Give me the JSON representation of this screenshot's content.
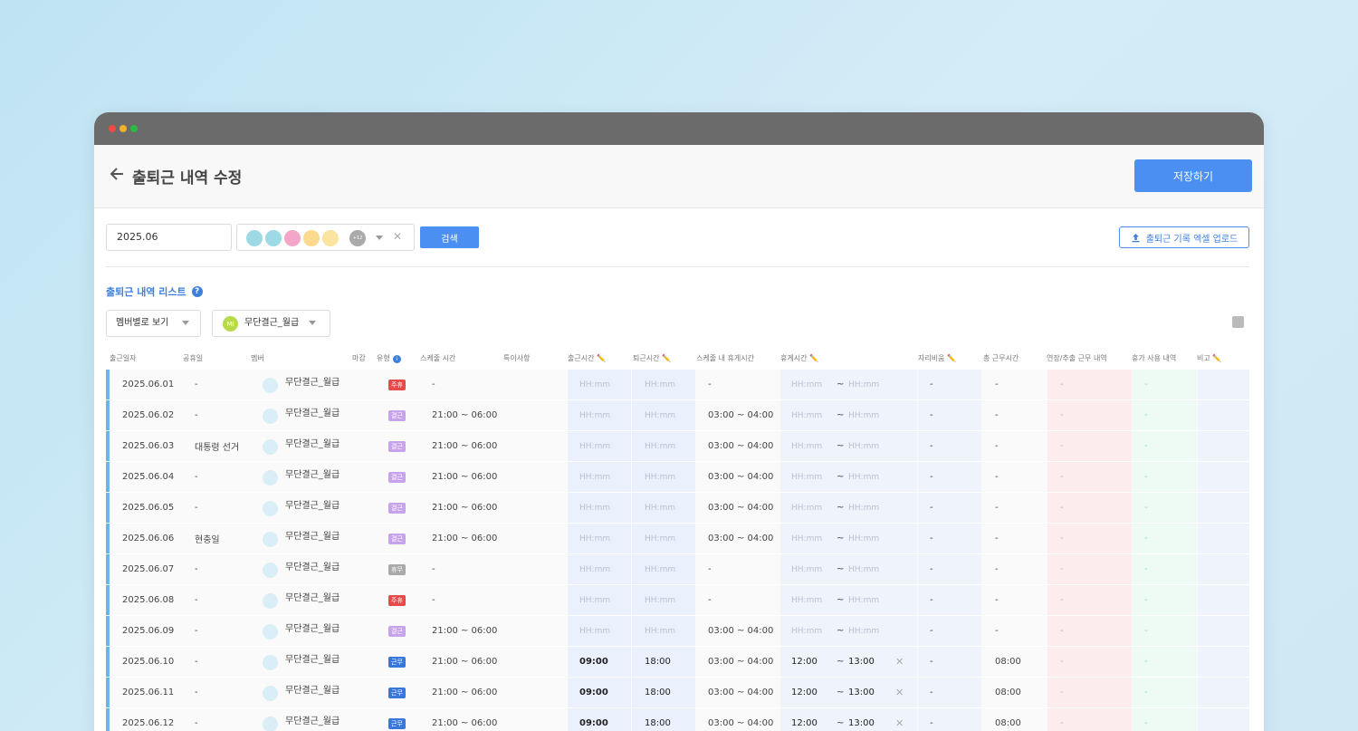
{
  "header": {
    "title": "출퇴근 내역 수정",
    "save_label": "저장하기"
  },
  "filters": {
    "date": "2025.06",
    "member_more": "+12",
    "search_label": "검색",
    "upload_label": "출퇴근 기록 엑셀 업로드"
  },
  "list": {
    "title": "출퇴근 내역 리스트",
    "view_select": "멤버별로 보기",
    "member_select": "무단결근_월급",
    "member_initials": "MI"
  },
  "columns": [
    "출근일자",
    "공휴일",
    "멤버",
    "마감",
    "유형",
    "스케줄 시간",
    "특이사항",
    "출근시간",
    "퇴근시간",
    "스케줄 내 휴게시간",
    "휴게시간",
    "자리비움",
    "총 근무시간",
    "연장/추출 근무 내역",
    "휴가 사용 내역",
    "비고"
  ],
  "placeholders": {
    "time": "HH:mm",
    "tilde": "~",
    "dash": "-"
  },
  "rows": [
    {
      "date": "2025.06.01",
      "holiday": "-",
      "member": "무단결근_월급",
      "type": "주휴",
      "type_color": "red",
      "schedule": "-",
      "in": "",
      "out": "",
      "sched_break": "-",
      "break_start": "",
      "break_end": "",
      "away": "-",
      "total": "-",
      "overtime": "-",
      "leave": "-"
    },
    {
      "date": "2025.06.02",
      "holiday": "-",
      "member": "무단결근_월급",
      "type": "결근",
      "type_color": "purple",
      "schedule": "21:00 ~ 06:00",
      "in": "",
      "out": "",
      "sched_break": "03:00 ~ 04:00",
      "break_start": "",
      "break_end": "",
      "away": "-",
      "total": "-",
      "overtime": "-",
      "leave": "-"
    },
    {
      "date": "2025.06.03",
      "holiday": "대통령 선거",
      "member": "무단결근_월급",
      "type": "결근",
      "type_color": "purple",
      "schedule": "21:00 ~ 06:00",
      "in": "",
      "out": "",
      "sched_break": "03:00 ~ 04:00",
      "break_start": "",
      "break_end": "",
      "away": "-",
      "total": "-",
      "overtime": "-",
      "leave": "-"
    },
    {
      "date": "2025.06.04",
      "holiday": "-",
      "member": "무단결근_월급",
      "type": "결근",
      "type_color": "purple",
      "schedule": "21:00 ~ 06:00",
      "in": "",
      "out": "",
      "sched_break": "03:00 ~ 04:00",
      "break_start": "",
      "break_end": "",
      "away": "-",
      "total": "-",
      "overtime": "-",
      "leave": "-"
    },
    {
      "date": "2025.06.05",
      "holiday": "-",
      "member": "무단결근_월급",
      "type": "결근",
      "type_color": "purple",
      "schedule": "21:00 ~ 06:00",
      "in": "",
      "out": "",
      "sched_break": "03:00 ~ 04:00",
      "break_start": "",
      "break_end": "",
      "away": "-",
      "total": "-",
      "overtime": "-",
      "leave": "-"
    },
    {
      "date": "2025.06.06",
      "holiday": "현충일",
      "member": "무단결근_월급",
      "type": "결근",
      "type_color": "purple",
      "schedule": "21:00 ~ 06:00",
      "in": "",
      "out": "",
      "sched_break": "03:00 ~ 04:00",
      "break_start": "",
      "break_end": "",
      "away": "-",
      "total": "-",
      "overtime": "-",
      "leave": "-"
    },
    {
      "date": "2025.06.07",
      "holiday": "-",
      "member": "무단결근_월급",
      "type": "휴무",
      "type_color": "gray",
      "schedule": "-",
      "in": "",
      "out": "",
      "sched_break": "-",
      "break_start": "",
      "break_end": "",
      "away": "-",
      "total": "-",
      "overtime": "-",
      "leave": "-"
    },
    {
      "date": "2025.06.08",
      "holiday": "-",
      "member": "무단결근_월급",
      "type": "주휴",
      "type_color": "red",
      "schedule": "-",
      "in": "",
      "out": "",
      "sched_break": "-",
      "break_start": "",
      "break_end": "",
      "away": "-",
      "total": "-",
      "overtime": "-",
      "leave": "-"
    },
    {
      "date": "2025.06.09",
      "holiday": "-",
      "member": "무단결근_월급",
      "type": "결근",
      "type_color": "purple",
      "schedule": "21:00 ~ 06:00",
      "in": "",
      "out": "",
      "sched_break": "03:00 ~ 04:00",
      "break_start": "",
      "break_end": "",
      "away": "-",
      "total": "-",
      "overtime": "-",
      "leave": "-"
    },
    {
      "date": "2025.06.10",
      "holiday": "-",
      "member": "무단결근_월급",
      "type": "근무",
      "type_color": "blue",
      "schedule": "21:00 ~ 06:00",
      "in": "09:00",
      "out": "18:00",
      "sched_break": "03:00 ~ 04:00",
      "break_start": "12:00",
      "break_end": "13:00",
      "away": "-",
      "total": "08:00",
      "overtime": "-",
      "leave": "-"
    },
    {
      "date": "2025.06.11",
      "holiday": "-",
      "member": "무단결근_월급",
      "type": "근무",
      "type_color": "blue",
      "schedule": "21:00 ~ 06:00",
      "in": "09:00",
      "out": "18:00",
      "sched_break": "03:00 ~ 04:00",
      "break_start": "12:00",
      "break_end": "13:00",
      "away": "-",
      "total": "08:00",
      "overtime": "-",
      "leave": "-"
    },
    {
      "date": "2025.06.12",
      "holiday": "-",
      "member": "무단결근_월급",
      "type": "근무",
      "type_color": "blue",
      "schedule": "21:00 ~ 06:00",
      "in": "09:00",
      "out": "18:00",
      "sched_break": "03:00 ~ 04:00",
      "break_start": "12:00",
      "break_end": "13:00",
      "away": "-",
      "total": "08:00",
      "overtime": "-",
      "leave": "-"
    }
  ]
}
